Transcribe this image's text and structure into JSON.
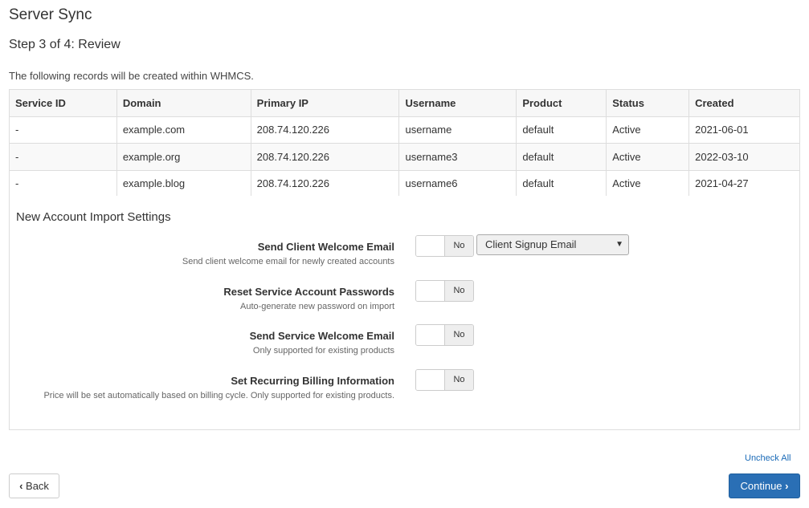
{
  "page": {
    "title": "Server Sync",
    "step": "Step 3 of 4: Review",
    "intro": "The following records will be created within WHMCS."
  },
  "table": {
    "headers": [
      "Service ID",
      "Domain",
      "Primary IP",
      "Username",
      "Product",
      "Status",
      "Created"
    ],
    "rows": [
      [
        "-",
        "example.com",
        "208.74.120.226",
        "username",
        "default",
        "Active",
        "2021-06-01"
      ],
      [
        "-",
        "example.org",
        "208.74.120.226",
        "username3",
        "default",
        "Active",
        "2022-03-10"
      ],
      [
        "-",
        "example.blog",
        "208.74.120.226",
        "username6",
        "default",
        "Active",
        "2021-04-27"
      ]
    ]
  },
  "settings": {
    "title": "New Account Import Settings",
    "items": [
      {
        "label": "Send Client Welcome Email",
        "help": "Send client welcome email for newly created accounts",
        "toggle": "No"
      },
      {
        "label": "Reset Service Account Passwords",
        "help": "Auto-generate new password on import",
        "toggle": "No"
      },
      {
        "label": "Send Service Welcome Email",
        "help": "Only supported for existing products",
        "toggle": "No"
      },
      {
        "label": "Set Recurring Billing Information",
        "help": "Price will be set automatically based on billing cycle. Only supported for existing products.",
        "toggle": "No"
      }
    ],
    "email_template_select": "Client Signup Email"
  },
  "actions": {
    "uncheck_all": "Uncheck All",
    "back": "Back",
    "continue": "Continue"
  },
  "colors": {
    "primary": "#2a6fb5",
    "link": "#1a6ab7",
    "border": "#dddddd"
  },
  "icons": {
    "back": "chevron-left-icon",
    "continue": "chevron-right-icon"
  }
}
